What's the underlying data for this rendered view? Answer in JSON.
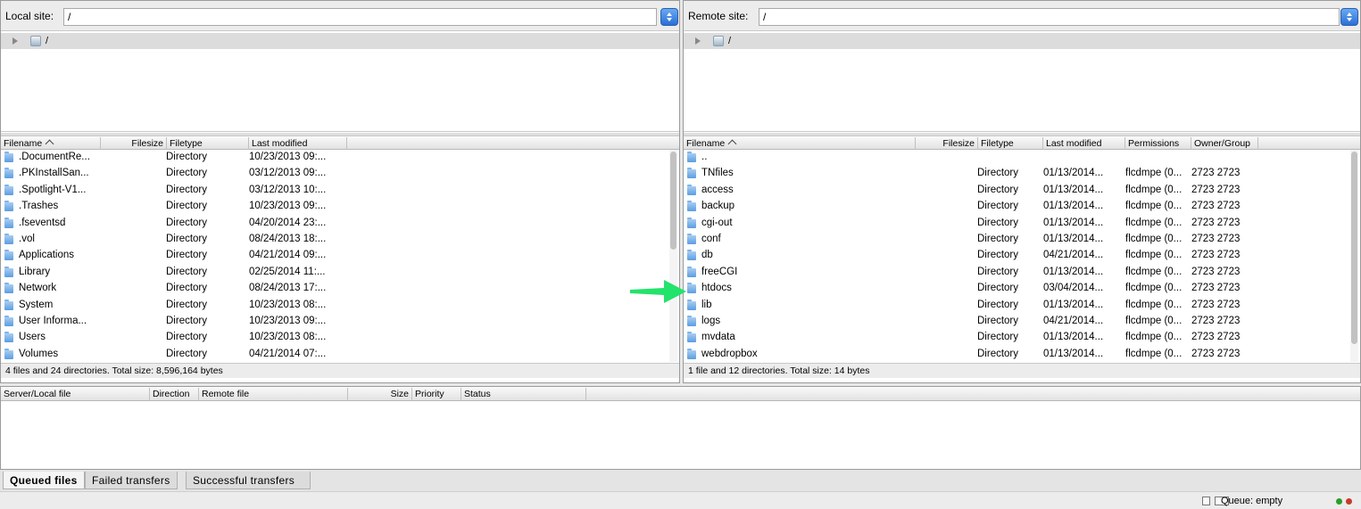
{
  "local": {
    "site_label": "Local site:",
    "path": "/",
    "tree_label": "/",
    "headers": [
      "Filename",
      "Filesize",
      "Filetype",
      "Last modified"
    ],
    "rows": [
      {
        "name": ".DocumentRe...",
        "size": "",
        "type": "Directory",
        "modified": "10/23/2013 09:..."
      },
      {
        "name": ".PKInstallSan...",
        "size": "",
        "type": "Directory",
        "modified": "03/12/2013 09:..."
      },
      {
        "name": ".Spotlight-V1...",
        "size": "",
        "type": "Directory",
        "modified": "03/12/2013 10:..."
      },
      {
        "name": ".Trashes",
        "size": "",
        "type": "Directory",
        "modified": "10/23/2013 09:..."
      },
      {
        "name": ".fseventsd",
        "size": "",
        "type": "Directory",
        "modified": "04/20/2014 23:..."
      },
      {
        "name": ".vol",
        "size": "",
        "type": "Directory",
        "modified": "08/24/2013 18:..."
      },
      {
        "name": "Applications",
        "size": "",
        "type": "Directory",
        "modified": "04/21/2014 09:..."
      },
      {
        "name": "Library",
        "size": "",
        "type": "Directory",
        "modified": "02/25/2014 11:..."
      },
      {
        "name": "Network",
        "size": "",
        "type": "Directory",
        "modified": "08/24/2013 17:..."
      },
      {
        "name": "System",
        "size": "",
        "type": "Directory",
        "modified": "10/23/2013 08:..."
      },
      {
        "name": "User Informa...",
        "size": "",
        "type": "Directory",
        "modified": "10/23/2013 09:..."
      },
      {
        "name": "Users",
        "size": "",
        "type": "Directory",
        "modified": "10/23/2013 08:..."
      },
      {
        "name": "Volumes",
        "size": "",
        "type": "Directory",
        "modified": "04/21/2014 07:..."
      }
    ],
    "status": "4 files and 24 directories. Total size: 8,596,164 bytes"
  },
  "remote": {
    "site_label": "Remote site:",
    "path": "/",
    "tree_label": "/",
    "headers": [
      "Filename",
      "Filesize",
      "Filetype",
      "Last modified",
      "Permissions",
      "Owner/Group"
    ],
    "rows": [
      {
        "name": "..",
        "size": "",
        "type": "",
        "modified": "",
        "perms": "",
        "owner": ""
      },
      {
        "name": "TNfiles",
        "size": "",
        "type": "Directory",
        "modified": "01/13/2014...",
        "perms": "flcdmpe (0...",
        "owner": "2723 2723"
      },
      {
        "name": "access",
        "size": "",
        "type": "Directory",
        "modified": "01/13/2014...",
        "perms": "flcdmpe (0...",
        "owner": "2723 2723"
      },
      {
        "name": "backup",
        "size": "",
        "type": "Directory",
        "modified": "01/13/2014...",
        "perms": "flcdmpe (0...",
        "owner": "2723 2723"
      },
      {
        "name": "cgi-out",
        "size": "",
        "type": "Directory",
        "modified": "01/13/2014...",
        "perms": "flcdmpe (0...",
        "owner": "2723 2723"
      },
      {
        "name": "conf",
        "size": "",
        "type": "Directory",
        "modified": "01/13/2014...",
        "perms": "flcdmpe (0...",
        "owner": "2723 2723"
      },
      {
        "name": "db",
        "size": "",
        "type": "Directory",
        "modified": "04/21/2014...",
        "perms": "flcdmpe (0...",
        "owner": "2723 2723"
      },
      {
        "name": "freeCGI",
        "size": "",
        "type": "Directory",
        "modified": "01/13/2014...",
        "perms": "flcdmpe (0...",
        "owner": "2723 2723"
      },
      {
        "name": "htdocs",
        "size": "",
        "type": "Directory",
        "modified": "03/04/2014...",
        "perms": "flcdmpe (0...",
        "owner": "2723 2723"
      },
      {
        "name": "lib",
        "size": "",
        "type": "Directory",
        "modified": "01/13/2014...",
        "perms": "flcdmpe (0...",
        "owner": "2723 2723"
      },
      {
        "name": "logs",
        "size": "",
        "type": "Directory",
        "modified": "04/21/2014...",
        "perms": "flcdmpe (0...",
        "owner": "2723 2723"
      },
      {
        "name": "mvdata",
        "size": "",
        "type": "Directory",
        "modified": "01/13/2014...",
        "perms": "flcdmpe (0...",
        "owner": "2723 2723"
      },
      {
        "name": "webdropbox",
        "size": "",
        "type": "Directory",
        "modified": "01/13/2014...",
        "perms": "flcdmpe (0...",
        "owner": "2723 2723"
      }
    ],
    "status": "1 file and 12 directories. Total size: 14 bytes"
  },
  "queue": {
    "headers": [
      "Server/Local file",
      "Direction",
      "Remote file",
      "Size",
      "Priority",
      "Status"
    ]
  },
  "tabs": [
    "Queued files",
    "Failed transfers",
    "Successful transfers"
  ],
  "statusbar": {
    "queue_text": "Queue: empty",
    "led_colors": [
      "#2a9d2a",
      "#c83a2a"
    ]
  },
  "annotation": {
    "arrow_color": "#22e36b"
  }
}
